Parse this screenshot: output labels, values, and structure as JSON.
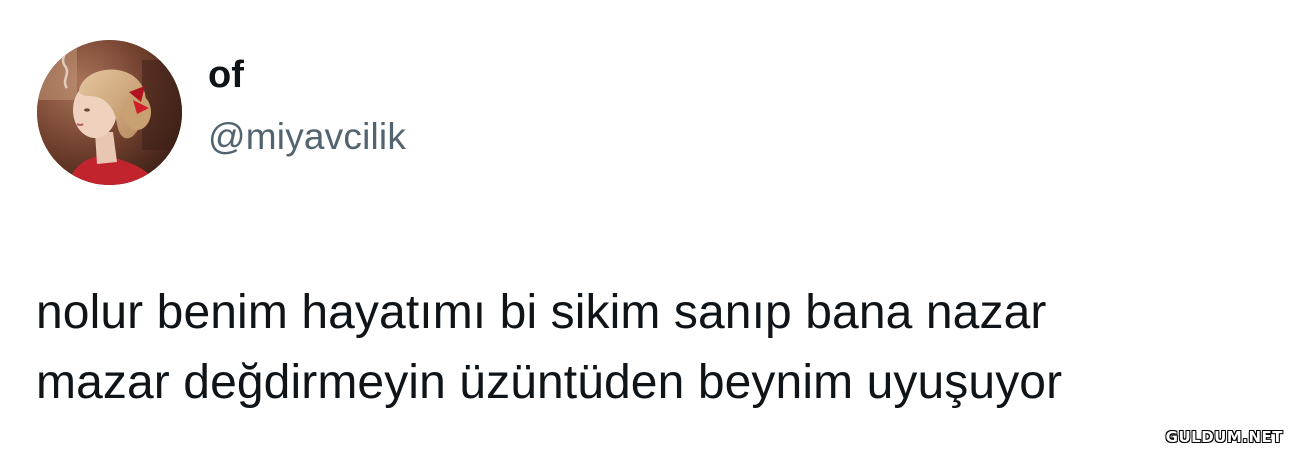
{
  "tweet": {
    "author": {
      "display_name": "of",
      "handle": "@miyavcilik",
      "avatar_icon": "profile-avatar-photo"
    },
    "text": "nolur benim hayatımı bi sikim sanıp bana nazar\nmazar değdirmeyin üzüntüden beynim uyuşuyor"
  },
  "watermark": {
    "text": "GULDUM.NET"
  },
  "colors": {
    "background": "#ffffff",
    "primary_text": "#0f1419",
    "secondary_text": "#536471"
  }
}
